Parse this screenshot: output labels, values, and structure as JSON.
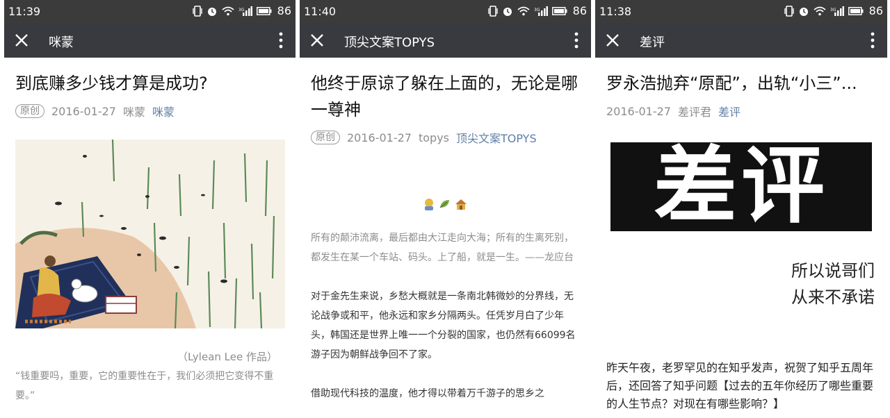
{
  "colors": {
    "status_bar": "#3b3b3b",
    "nav_bar": "#393a3f",
    "link": "#607fa6",
    "meta_grey": "#8c8c8c"
  },
  "screens": [
    {
      "status": {
        "time": "11:39",
        "battery": "86"
      },
      "nav": {
        "title": "咪蒙"
      },
      "article": {
        "title": "到底赚多少钱才算是成功?",
        "tag": "原创",
        "date": "2016-01-27",
        "author": "咪蒙",
        "account": "咪蒙",
        "caption": "（Lylean Lee 作品）",
        "quote": "“钱重要吗，重要，它的重要性在于，我们必须把它变得不重要。”"
      }
    },
    {
      "status": {
        "time": "11:40",
        "battery": "86"
      },
      "nav": {
        "title": "顶尖文案TOPYS"
      },
      "article": {
        "title": "他终于原谅了躲在上面的，无论是哪一尊神",
        "tag": "原创",
        "date": "2016-01-27",
        "author": "topys",
        "account": "顶尖文案TOPYS",
        "para1": "所有的颠沛流离，最后都由大江走向大海；所有的生离死别，都发生在某一个车站、码头。上了船，就是一生。——龙应台",
        "para2": "对于金先生来说，乡愁大概就是一条南北韩微妙的分界线，无论战争或和平，他永远和家乡分隔两头。任凭岁月白了少年头，韩国还是世界上唯一一个分裂的国家，也仍然有66099名游子因为朝鲜战争回不了家。",
        "para3": "借助现代科技的温度，他才得以带着万千游子的思乡之"
      }
    },
    {
      "status": {
        "time": "11:38",
        "battery": "86"
      },
      "nav": {
        "title": "差评"
      },
      "article": {
        "title": "罗永浩抛弃“原配”，出轨“小三”...",
        "date": "2016-01-27",
        "author": "差评君",
        "account": "差评",
        "logo_text": "差评",
        "line1": "所以说哥们",
        "line2": "从来不承诺",
        "para": "昨天午夜，老罗罕见的在知乎发声，祝贺了知乎五周年后，还回答了知乎问题【过去的五年你经历了哪些重要的人生节点？对现在有哪些影响？】"
      }
    }
  ]
}
